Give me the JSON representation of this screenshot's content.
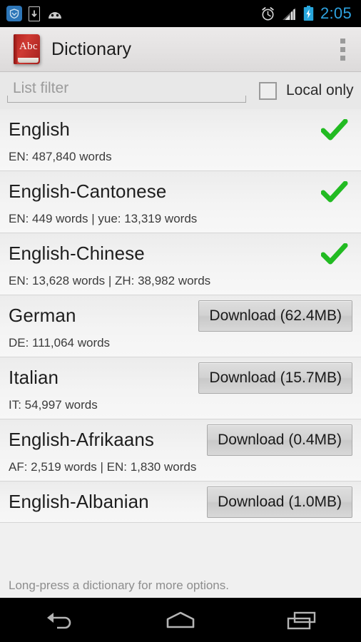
{
  "statusbar": {
    "time": "2:05",
    "left_icons": [
      "shield-app-icon",
      "download-icon",
      "android-head-icon"
    ],
    "right_icons": [
      "alarm-icon",
      "signal-bars-icon",
      "battery-charging-icon"
    ],
    "accent_color": "#2ea3e0"
  },
  "actionbar": {
    "app_icon_text": "Abc",
    "title": "Dictionary",
    "overflow_label": "More options"
  },
  "filter": {
    "placeholder": "List filter",
    "value": "",
    "checkbox_label": "Local only",
    "checkbox_checked": false
  },
  "list": {
    "rows": [
      {
        "title": "English",
        "subtitle": "EN: 487,840 words",
        "installed": true,
        "action": null
      },
      {
        "title": "English-Cantonese",
        "subtitle": "EN: 449 words | yue: 13,319 words",
        "installed": true,
        "action": null
      },
      {
        "title": "English-Chinese",
        "subtitle": "EN: 13,628 words | ZH: 38,982 words",
        "installed": true,
        "action": null
      },
      {
        "title": "German",
        "subtitle": "DE: 111,064 words",
        "installed": false,
        "action": "Download (62.4MB)"
      },
      {
        "title": "Italian",
        "subtitle": "IT: 54,997 words",
        "installed": false,
        "action": "Download (15.7MB)"
      },
      {
        "title": "English-Afrikaans",
        "subtitle": "AF: 2,519 words | EN: 1,830 words",
        "installed": false,
        "action": "Download (0.4MB)"
      },
      {
        "title": "English-Albanian",
        "subtitle": "",
        "installed": false,
        "action": "Download (1.0MB)"
      }
    ],
    "check_color": "#22bb22"
  },
  "footer": {
    "hint": "Long-press a dictionary for more options."
  },
  "navbar": {
    "back_label": "Back",
    "home_label": "Home",
    "recents_label": "Recent apps"
  }
}
